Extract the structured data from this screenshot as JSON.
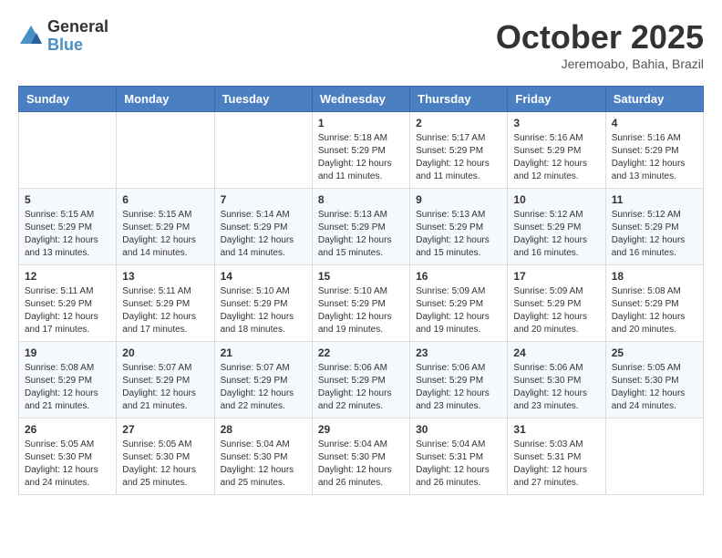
{
  "header": {
    "logo_general": "General",
    "logo_blue": "Blue",
    "month_title": "October 2025",
    "location": "Jeremoabo, Bahia, Brazil"
  },
  "weekdays": [
    "Sunday",
    "Monday",
    "Tuesday",
    "Wednesday",
    "Thursday",
    "Friday",
    "Saturday"
  ],
  "weeks": [
    [
      {
        "day": "",
        "info": ""
      },
      {
        "day": "",
        "info": ""
      },
      {
        "day": "",
        "info": ""
      },
      {
        "day": "1",
        "info": "Sunrise: 5:18 AM\nSunset: 5:29 PM\nDaylight: 12 hours\nand 11 minutes."
      },
      {
        "day": "2",
        "info": "Sunrise: 5:17 AM\nSunset: 5:29 PM\nDaylight: 12 hours\nand 11 minutes."
      },
      {
        "day": "3",
        "info": "Sunrise: 5:16 AM\nSunset: 5:29 PM\nDaylight: 12 hours\nand 12 minutes."
      },
      {
        "day": "4",
        "info": "Sunrise: 5:16 AM\nSunset: 5:29 PM\nDaylight: 12 hours\nand 13 minutes."
      }
    ],
    [
      {
        "day": "5",
        "info": "Sunrise: 5:15 AM\nSunset: 5:29 PM\nDaylight: 12 hours\nand 13 minutes."
      },
      {
        "day": "6",
        "info": "Sunrise: 5:15 AM\nSunset: 5:29 PM\nDaylight: 12 hours\nand 14 minutes."
      },
      {
        "day": "7",
        "info": "Sunrise: 5:14 AM\nSunset: 5:29 PM\nDaylight: 12 hours\nand 14 minutes."
      },
      {
        "day": "8",
        "info": "Sunrise: 5:13 AM\nSunset: 5:29 PM\nDaylight: 12 hours\nand 15 minutes."
      },
      {
        "day": "9",
        "info": "Sunrise: 5:13 AM\nSunset: 5:29 PM\nDaylight: 12 hours\nand 15 minutes."
      },
      {
        "day": "10",
        "info": "Sunrise: 5:12 AM\nSunset: 5:29 PM\nDaylight: 12 hours\nand 16 minutes."
      },
      {
        "day": "11",
        "info": "Sunrise: 5:12 AM\nSunset: 5:29 PM\nDaylight: 12 hours\nand 16 minutes."
      }
    ],
    [
      {
        "day": "12",
        "info": "Sunrise: 5:11 AM\nSunset: 5:29 PM\nDaylight: 12 hours\nand 17 minutes."
      },
      {
        "day": "13",
        "info": "Sunrise: 5:11 AM\nSunset: 5:29 PM\nDaylight: 12 hours\nand 17 minutes."
      },
      {
        "day": "14",
        "info": "Sunrise: 5:10 AM\nSunset: 5:29 PM\nDaylight: 12 hours\nand 18 minutes."
      },
      {
        "day": "15",
        "info": "Sunrise: 5:10 AM\nSunset: 5:29 PM\nDaylight: 12 hours\nand 19 minutes."
      },
      {
        "day": "16",
        "info": "Sunrise: 5:09 AM\nSunset: 5:29 PM\nDaylight: 12 hours\nand 19 minutes."
      },
      {
        "day": "17",
        "info": "Sunrise: 5:09 AM\nSunset: 5:29 PM\nDaylight: 12 hours\nand 20 minutes."
      },
      {
        "day": "18",
        "info": "Sunrise: 5:08 AM\nSunset: 5:29 PM\nDaylight: 12 hours\nand 20 minutes."
      }
    ],
    [
      {
        "day": "19",
        "info": "Sunrise: 5:08 AM\nSunset: 5:29 PM\nDaylight: 12 hours\nand 21 minutes."
      },
      {
        "day": "20",
        "info": "Sunrise: 5:07 AM\nSunset: 5:29 PM\nDaylight: 12 hours\nand 21 minutes."
      },
      {
        "day": "21",
        "info": "Sunrise: 5:07 AM\nSunset: 5:29 PM\nDaylight: 12 hours\nand 22 minutes."
      },
      {
        "day": "22",
        "info": "Sunrise: 5:06 AM\nSunset: 5:29 PM\nDaylight: 12 hours\nand 22 minutes."
      },
      {
        "day": "23",
        "info": "Sunrise: 5:06 AM\nSunset: 5:29 PM\nDaylight: 12 hours\nand 23 minutes."
      },
      {
        "day": "24",
        "info": "Sunrise: 5:06 AM\nSunset: 5:30 PM\nDaylight: 12 hours\nand 23 minutes."
      },
      {
        "day": "25",
        "info": "Sunrise: 5:05 AM\nSunset: 5:30 PM\nDaylight: 12 hours\nand 24 minutes."
      }
    ],
    [
      {
        "day": "26",
        "info": "Sunrise: 5:05 AM\nSunset: 5:30 PM\nDaylight: 12 hours\nand 24 minutes."
      },
      {
        "day": "27",
        "info": "Sunrise: 5:05 AM\nSunset: 5:30 PM\nDaylight: 12 hours\nand 25 minutes."
      },
      {
        "day": "28",
        "info": "Sunrise: 5:04 AM\nSunset: 5:30 PM\nDaylight: 12 hours\nand 25 minutes."
      },
      {
        "day": "29",
        "info": "Sunrise: 5:04 AM\nSunset: 5:30 PM\nDaylight: 12 hours\nand 26 minutes."
      },
      {
        "day": "30",
        "info": "Sunrise: 5:04 AM\nSunset: 5:31 PM\nDaylight: 12 hours\nand 26 minutes."
      },
      {
        "day": "31",
        "info": "Sunrise: 5:03 AM\nSunset: 5:31 PM\nDaylight: 12 hours\nand 27 minutes."
      },
      {
        "day": "",
        "info": ""
      }
    ]
  ]
}
